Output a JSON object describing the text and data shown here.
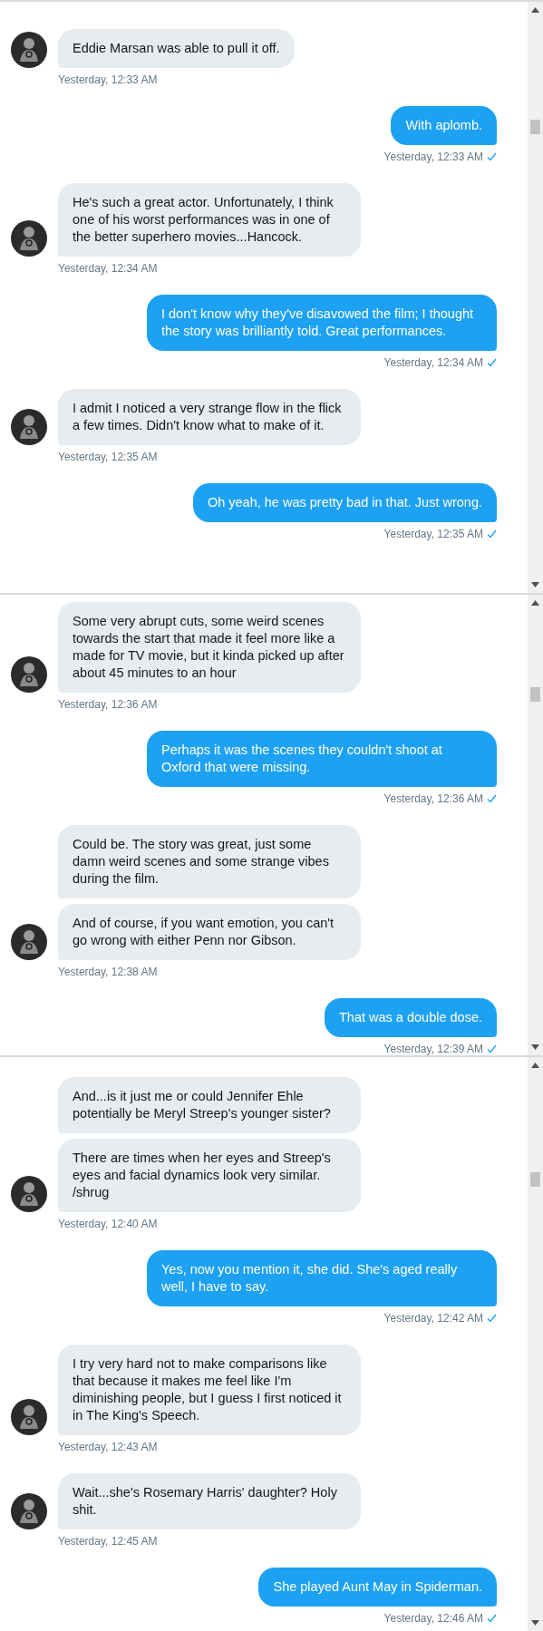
{
  "panels": [
    {
      "groups": [
        {
          "kind": "incoming",
          "bubbles": [
            "Eddie Marsan was able to pull it off."
          ],
          "time": "Yesterday, 12:33 AM"
        },
        {
          "kind": "outgoing",
          "bubbles": [
            "With aplomb."
          ],
          "time": "Yesterday, 12:33 AM",
          "read": true
        },
        {
          "kind": "incoming",
          "bubbles": [
            "He's such a great actor. Unfortunately, I think one of his worst performances was in one of the better superhero movies...Hancock."
          ],
          "time": "Yesterday, 12:34 AM"
        },
        {
          "kind": "outgoing",
          "bubbles": [
            "I don't know why they've disavowed the film; I thought the story was brilliantly told. Great performances."
          ],
          "time": "Yesterday, 12:34 AM",
          "read": true
        },
        {
          "kind": "incoming",
          "bubbles": [
            "I admit I noticed a very strange flow in the flick a few times. Didn't know what to make of it."
          ],
          "time": "Yesterday, 12:35 AM"
        },
        {
          "kind": "outgoing",
          "bubbles": [
            "Oh yeah, he was pretty bad in that. Just wrong."
          ],
          "time": "Yesterday, 12:35 AM",
          "read": true
        }
      ]
    },
    {
      "groups": [
        {
          "kind": "incoming",
          "bubbles": [
            "Some very abrupt cuts, some weird scenes towards the start that made it feel more like a made for TV movie, but it kinda picked up after about 45 minutes to an hour"
          ],
          "time": "Yesterday, 12:36 AM"
        },
        {
          "kind": "outgoing",
          "bubbles": [
            "Perhaps it was the scenes they couldn't shoot at Oxford that were missing."
          ],
          "time": "Yesterday, 12:36 AM",
          "read": true
        },
        {
          "kind": "incoming",
          "bubbles": [
            "Could be. The story was great, just some damn weird scenes and some strange vibes during the film.",
            "And of course, if you want emotion, you can't go wrong with either Penn nor Gibson."
          ],
          "time": "Yesterday, 12:38 AM"
        },
        {
          "kind": "outgoing",
          "bubbles": [
            "That was a double dose."
          ],
          "time": "Yesterday, 12:39 AM",
          "read": true
        }
      ]
    },
    {
      "groups": [
        {
          "kind": "incoming",
          "bubbles": [
            "And...is it just me or could Jennifer Ehle potentially be Meryl Streep's younger sister?",
            "There are times when her eyes and Streep's eyes and facial dynamics look very similar. /shrug"
          ],
          "time": "Yesterday, 12:40 AM"
        },
        {
          "kind": "outgoing",
          "bubbles": [
            "Yes, now you mention it, she did. She's aged really well, I have to say."
          ],
          "time": "Yesterday, 12:42 AM",
          "read": true
        },
        {
          "kind": "incoming",
          "bubbles": [
            "I try very hard not to make comparisons like that because it makes me feel like I'm diminishing people, but I guess I first noticed it in The King's Speech."
          ],
          "time": "Yesterday, 12:43 AM"
        },
        {
          "kind": "incoming",
          "bubbles": [
            "Wait...she's Rosemary Harris' daughter? Holy shit."
          ],
          "time": "Yesterday, 12:45 AM"
        },
        {
          "kind": "outgoing",
          "bubbles": [
            "She played Aunt May in Spiderman."
          ],
          "time": "Yesterday, 12:46 AM",
          "read": true
        }
      ]
    }
  ]
}
